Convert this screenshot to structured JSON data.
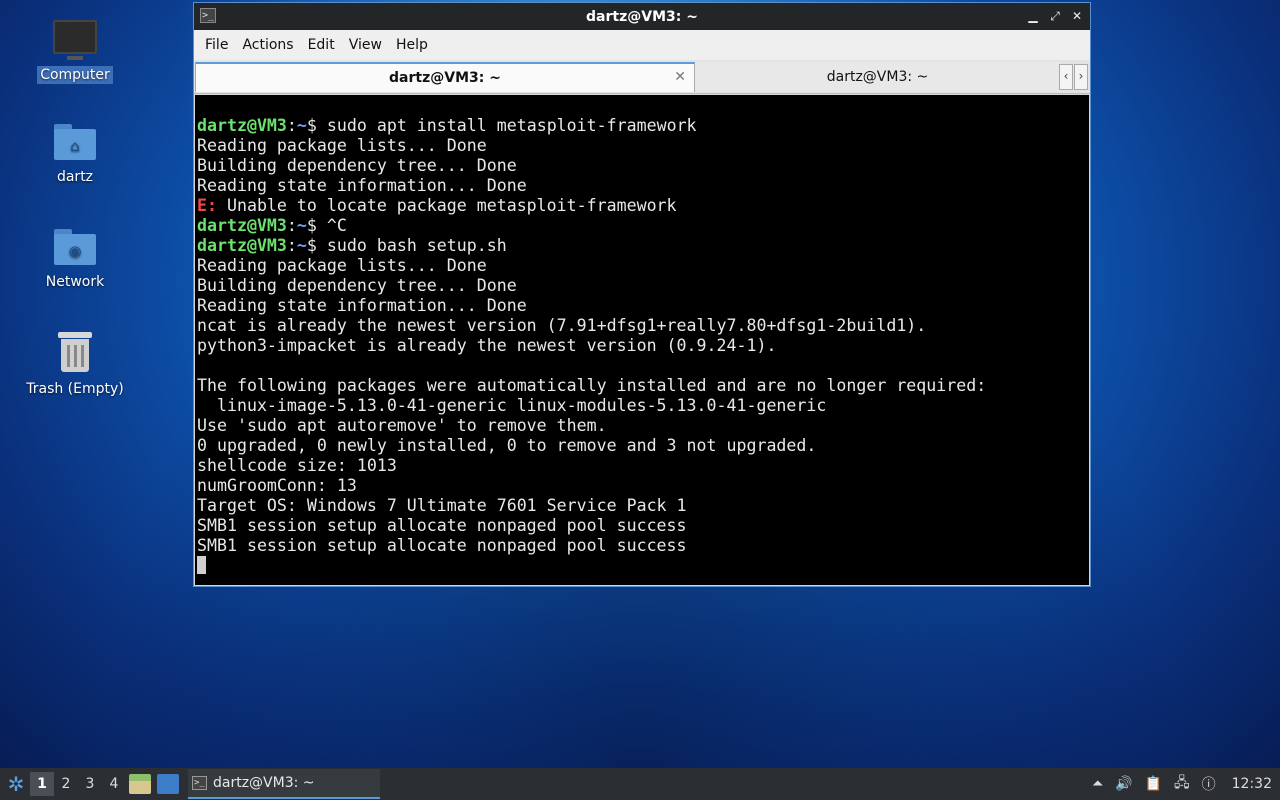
{
  "desktop": {
    "icons": [
      {
        "label": "Computer",
        "icon": "computer-icon"
      },
      {
        "label": "dartz",
        "icon": "home-folder-icon"
      },
      {
        "label": "Network",
        "icon": "network-folder-icon"
      },
      {
        "label": "Trash (Empty)",
        "icon": "trash-icon"
      }
    ]
  },
  "window": {
    "title": "dartz@VM3: ~",
    "menu": [
      "File",
      "Actions",
      "Edit",
      "View",
      "Help"
    ],
    "tabs": [
      {
        "label": "dartz@VM3: ~",
        "active": true
      },
      {
        "label": "dartz@VM3: ~",
        "active": false
      }
    ],
    "prompt_user": "dartz@VM3",
    "prompt_sep": ":",
    "prompt_path": "~",
    "prompt_end": "$ ",
    "terminal": [
      {
        "type": "prompt",
        "cmd": "sudo apt install metasploit-framework"
      },
      {
        "type": "out",
        "text": "Reading package lists... Done"
      },
      {
        "type": "out",
        "text": "Building dependency tree... Done"
      },
      {
        "type": "out",
        "text": "Reading state information... Done"
      },
      {
        "type": "err",
        "prefix": "E:",
        "text": " Unable to locate package metasploit-framework"
      },
      {
        "type": "prompt",
        "cmd": "^C"
      },
      {
        "type": "prompt",
        "cmd": "sudo bash setup.sh"
      },
      {
        "type": "out",
        "text": "Reading package lists... Done"
      },
      {
        "type": "out",
        "text": "Building dependency tree... Done"
      },
      {
        "type": "out",
        "text": "Reading state information... Done"
      },
      {
        "type": "out",
        "text": "ncat is already the newest version (7.91+dfsg1+really7.80+dfsg1-2build1)."
      },
      {
        "type": "out",
        "text": "python3-impacket is already the newest version (0.9.24-1)."
      },
      {
        "type": "out",
        "text": ""
      },
      {
        "type": "out",
        "text": "The following packages were automatically installed and are no longer required:"
      },
      {
        "type": "out",
        "text": "  linux-image-5.13.0-41-generic linux-modules-5.13.0-41-generic"
      },
      {
        "type": "out",
        "text": "Use 'sudo apt autoremove' to remove them."
      },
      {
        "type": "out",
        "text": "0 upgraded, 0 newly installed, 0 to remove and 3 not upgraded."
      },
      {
        "type": "out",
        "text": "shellcode size: 1013"
      },
      {
        "type": "out",
        "text": "numGroomConn: 13"
      },
      {
        "type": "out",
        "text": "Target OS: Windows 7 Ultimate 7601 Service Pack 1"
      },
      {
        "type": "out",
        "text": "SMB1 session setup allocate nonpaged pool success"
      },
      {
        "type": "out",
        "text": "SMB1 session setup allocate nonpaged pool success"
      },
      {
        "type": "cursor"
      }
    ]
  },
  "taskbar": {
    "desktops": [
      "1",
      "2",
      "3",
      "4"
    ],
    "active_desktop": 0,
    "task_label": "dartz@VM3: ~",
    "clock": "12:32"
  }
}
